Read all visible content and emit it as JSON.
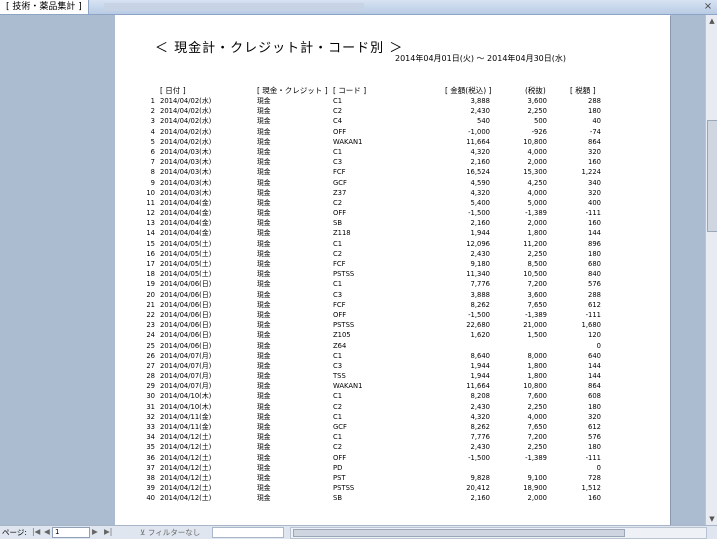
{
  "window": {
    "tab_title": "[ 技術・薬品集計 ]",
    "close": "×"
  },
  "report": {
    "title": "＜ 現金計・クレジット計・コード別 ＞",
    "date_range": "2014年04月01日(火) ～ 2014年04月30日(水)",
    "headers": {
      "date": "[ 日付 ]",
      "kind": "[ 現金・クレジット ]",
      "code": "[ コード ]",
      "amount": "[ 金額(税込) ]",
      "tax0": "(税抜)",
      "tax": "[ 税額 ]"
    },
    "rows": [
      [
        "1",
        "2014/04/02(水)",
        "現金",
        "C1",
        "3,888",
        "3,600",
        "288"
      ],
      [
        "2",
        "2014/04/02(水)",
        "現金",
        "C2",
        "2,430",
        "2,250",
        "180"
      ],
      [
        "3",
        "2014/04/02(水)",
        "現金",
        "C4",
        "540",
        "500",
        "40"
      ],
      [
        "4",
        "2014/04/02(水)",
        "現金",
        "OFF",
        "-1,000",
        "-926",
        "-74"
      ],
      [
        "5",
        "2014/04/02(水)",
        "現金",
        "WAKAN1",
        "11,664",
        "10,800",
        "864"
      ],
      [
        "6",
        "2014/04/03(木)",
        "現金",
        "C1",
        "4,320",
        "4,000",
        "320"
      ],
      [
        "7",
        "2014/04/03(木)",
        "現金",
        "C3",
        "2,160",
        "2,000",
        "160"
      ],
      [
        "8",
        "2014/04/03(木)",
        "現金",
        "FCF",
        "16,524",
        "15,300",
        "1,224"
      ],
      [
        "9",
        "2014/04/03(木)",
        "現金",
        "GCF",
        "4,590",
        "4,250",
        "340"
      ],
      [
        "10",
        "2014/04/03(木)",
        "現金",
        "Z37",
        "4,320",
        "4,000",
        "320"
      ],
      [
        "11",
        "2014/04/04(金)",
        "現金",
        "C2",
        "5,400",
        "5,000",
        "400"
      ],
      [
        "12",
        "2014/04/04(金)",
        "現金",
        "OFF",
        "-1,500",
        "-1,389",
        "-111"
      ],
      [
        "13",
        "2014/04/04(金)",
        "現金",
        "SB",
        "2,160",
        "2,000",
        "160"
      ],
      [
        "14",
        "2014/04/04(金)",
        "現金",
        "Z118",
        "1,944",
        "1,800",
        "144"
      ],
      [
        "15",
        "2014/04/05(土)",
        "現金",
        "C1",
        "12,096",
        "11,200",
        "896"
      ],
      [
        "16",
        "2014/04/05(土)",
        "現金",
        "C2",
        "2,430",
        "2,250",
        "180"
      ],
      [
        "17",
        "2014/04/05(土)",
        "現金",
        "FCF",
        "9,180",
        "8,500",
        "680"
      ],
      [
        "18",
        "2014/04/05(土)",
        "現金",
        "PSTSS",
        "11,340",
        "10,500",
        "840"
      ],
      [
        "19",
        "2014/04/06(日)",
        "現金",
        "C1",
        "7,776",
        "7,200",
        "576"
      ],
      [
        "20",
        "2014/04/06(日)",
        "現金",
        "C3",
        "3,888",
        "3,600",
        "288"
      ],
      [
        "21",
        "2014/04/06(日)",
        "現金",
        "FCF",
        "8,262",
        "7,650",
        "612"
      ],
      [
        "22",
        "2014/04/06(日)",
        "現金",
        "OFF",
        "-1,500",
        "-1,389",
        "-111"
      ],
      [
        "23",
        "2014/04/06(日)",
        "現金",
        "PSTSS",
        "22,680",
        "21,000",
        "1,680"
      ],
      [
        "24",
        "2014/04/06(日)",
        "現金",
        "Z105",
        "1,620",
        "1,500",
        "120"
      ],
      [
        "25",
        "2014/04/06(日)",
        "現金",
        "Z64",
        "",
        "",
        "0"
      ],
      [
        "26",
        "2014/04/07(月)",
        "現金",
        "C1",
        "8,640",
        "8,000",
        "640"
      ],
      [
        "27",
        "2014/04/07(月)",
        "現金",
        "C3",
        "1,944",
        "1,800",
        "144"
      ],
      [
        "28",
        "2014/04/07(月)",
        "現金",
        "TSS",
        "1,944",
        "1,800",
        "144"
      ],
      [
        "29",
        "2014/04/07(月)",
        "現金",
        "WAKAN1",
        "11,664",
        "10,800",
        "864"
      ],
      [
        "30",
        "2014/04/10(木)",
        "現金",
        "C1",
        "8,208",
        "7,600",
        "608"
      ],
      [
        "31",
        "2014/04/10(木)",
        "現金",
        "C2",
        "2,430",
        "2,250",
        "180"
      ],
      [
        "32",
        "2014/04/11(金)",
        "現金",
        "C1",
        "4,320",
        "4,000",
        "320"
      ],
      [
        "33",
        "2014/04/11(金)",
        "現金",
        "GCF",
        "8,262",
        "7,650",
        "612"
      ],
      [
        "34",
        "2014/04/12(土)",
        "現金",
        "C1",
        "7,776",
        "7,200",
        "576"
      ],
      [
        "35",
        "2014/04/12(土)",
        "現金",
        "C2",
        "2,430",
        "2,250",
        "180"
      ],
      [
        "36",
        "2014/04/12(土)",
        "現金",
        "OFF",
        "-1,500",
        "-1,389",
        "-111"
      ],
      [
        "37",
        "2014/04/12(土)",
        "現金",
        "PD",
        "",
        "",
        "0"
      ],
      [
        "38",
        "2014/04/12(土)",
        "現金",
        "PST",
        "9,828",
        "9,100",
        "728"
      ],
      [
        "39",
        "2014/04/12(土)",
        "現金",
        "PSTSS",
        "20,412",
        "18,900",
        "1,512"
      ],
      [
        "40",
        "2014/04/12(土)",
        "現金",
        "SB",
        "2,160",
        "2,000",
        "160"
      ]
    ]
  },
  "navbar": {
    "page_label": "ページ:",
    "first": "|◀",
    "prev": "◀",
    "page_value": "1",
    "next": "▶",
    "last": "▶|",
    "filter": "フィルターなし"
  }
}
